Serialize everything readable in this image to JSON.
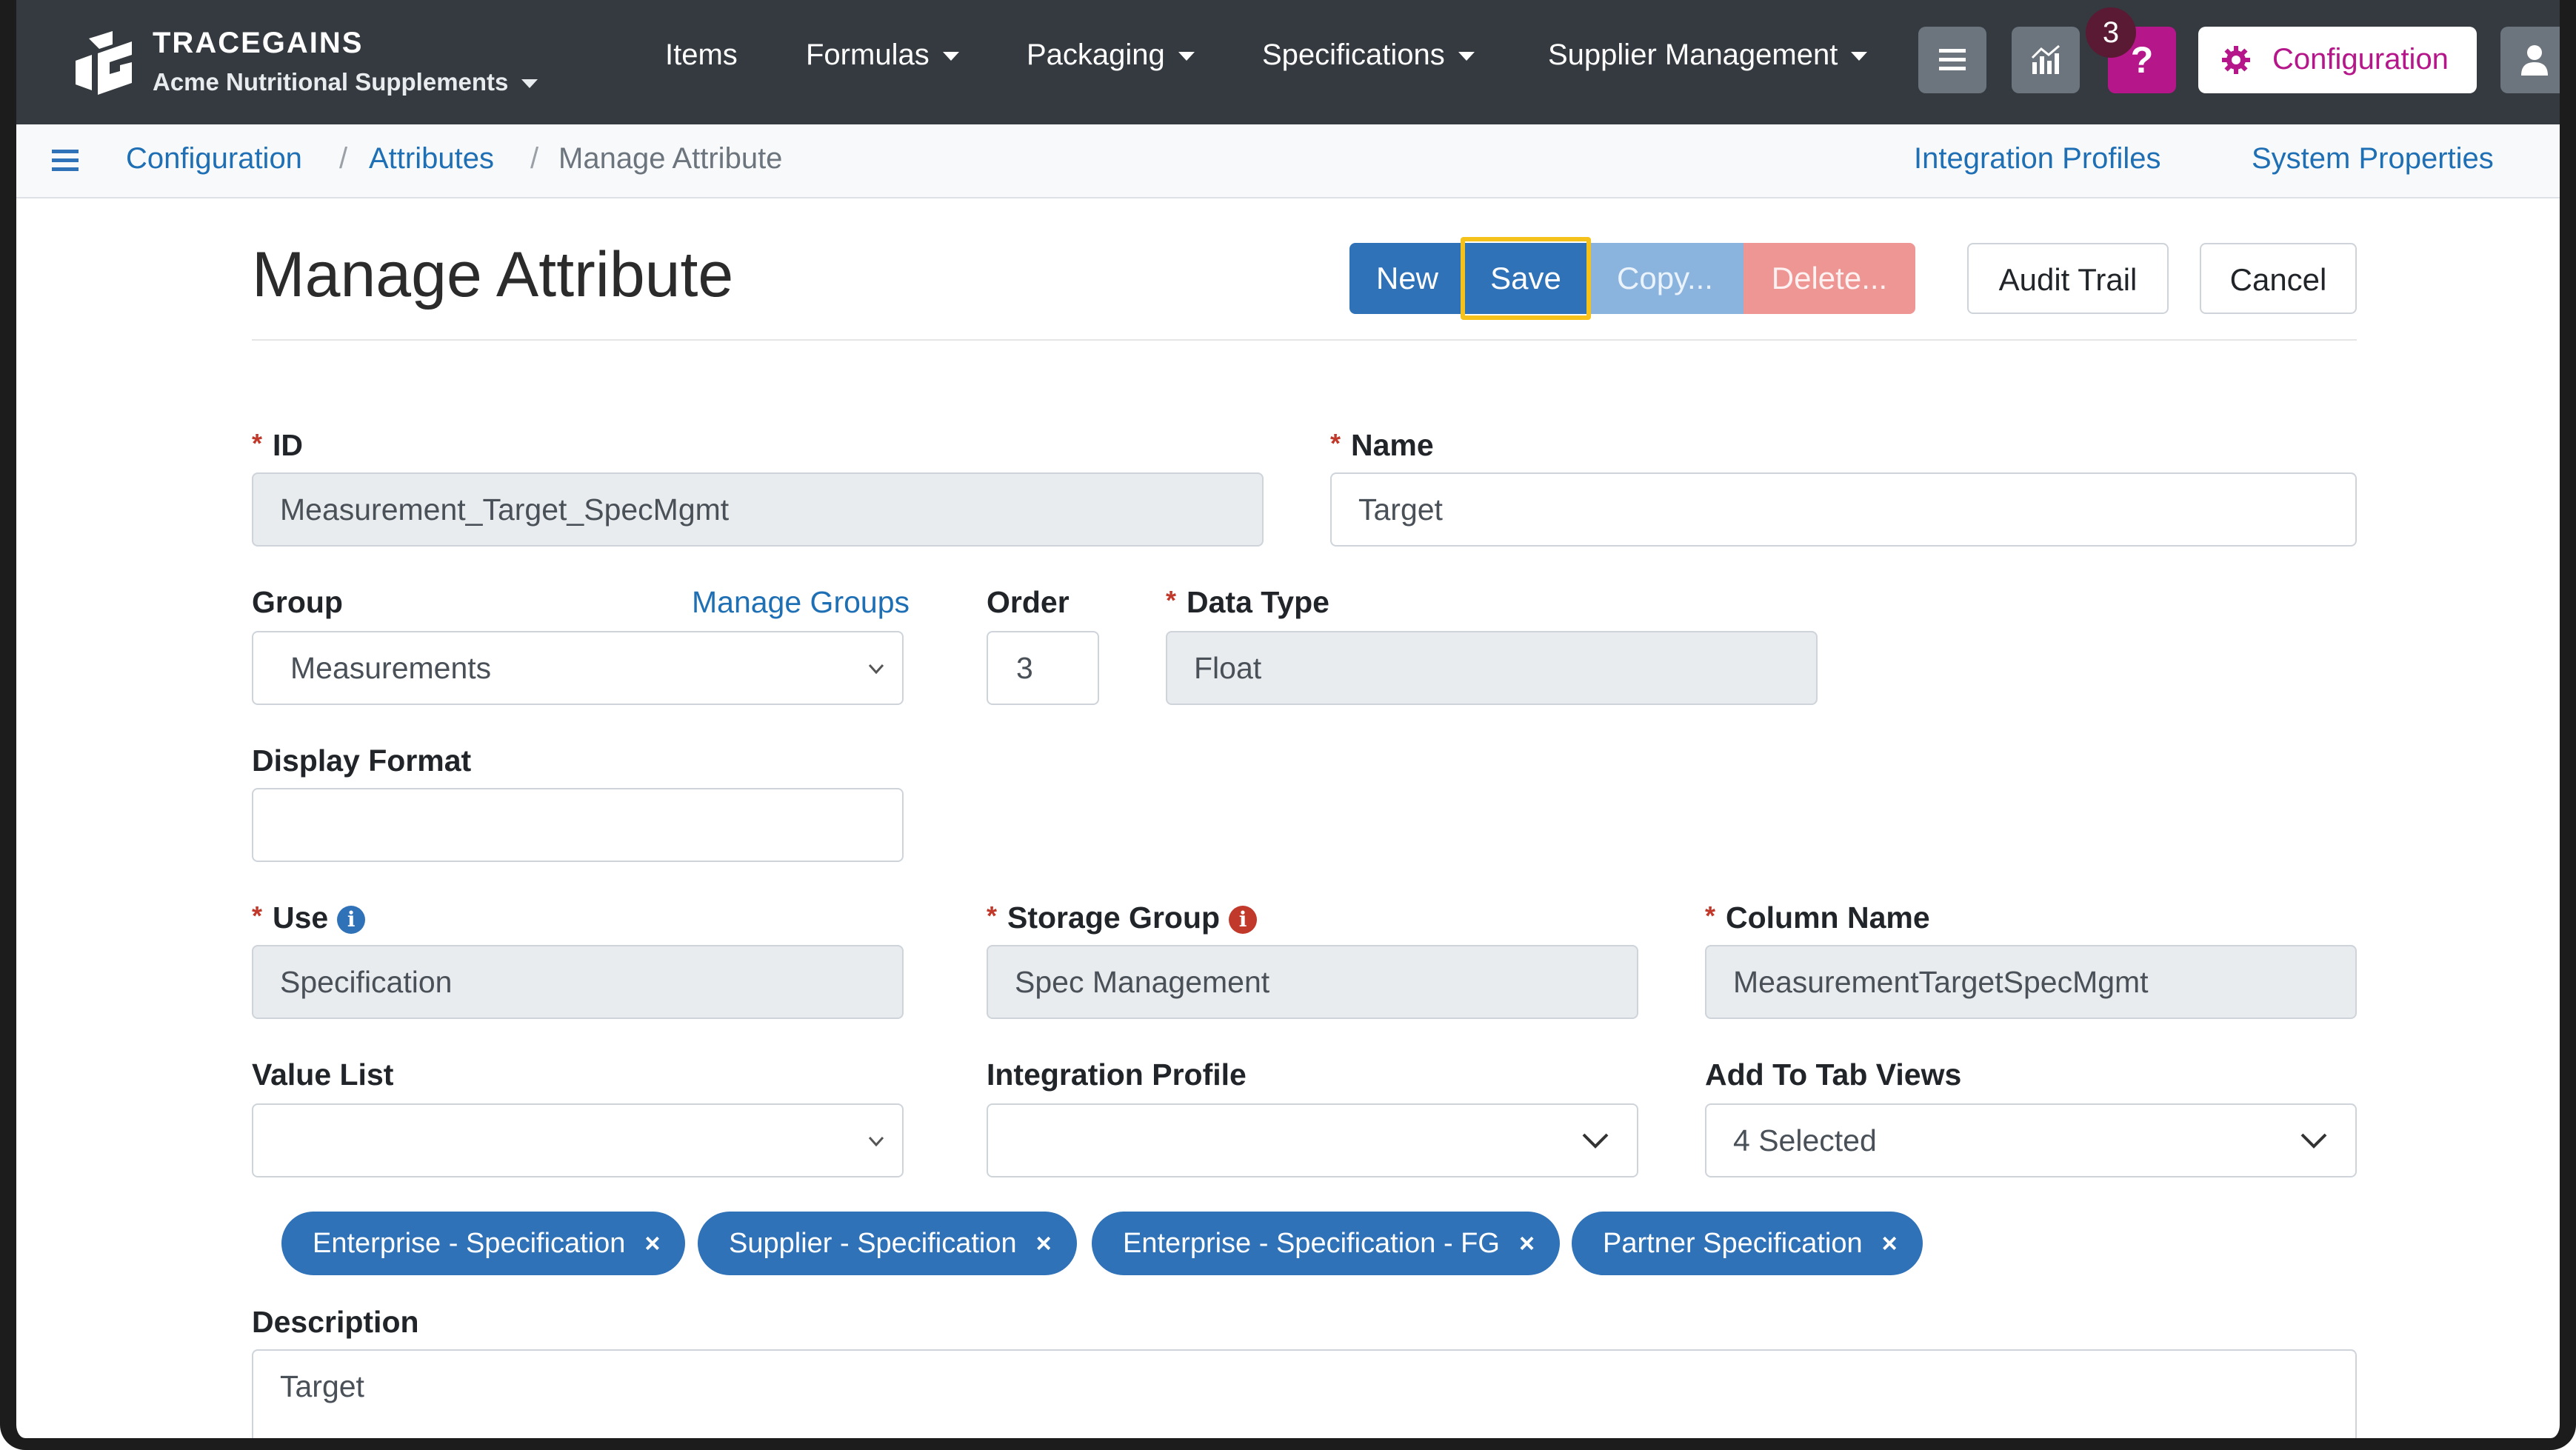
{
  "brand": {
    "name": "TRACEGAINS",
    "org": "Acme Nutritional Supplements"
  },
  "nav": {
    "items": [
      "Items",
      "Formulas",
      "Packaging",
      "Specifications",
      "Supplier Management"
    ],
    "notification_count": "3",
    "help_label": "?",
    "config_label": "Configuration"
  },
  "breadcrumb": {
    "items": [
      "Configuration",
      "Attributes",
      "Manage Attribute"
    ],
    "right_links": [
      "Integration Profiles",
      "System Properties"
    ]
  },
  "page": {
    "title": "Manage Attribute"
  },
  "toolbar": {
    "new_label": "New",
    "save_label": "Save",
    "copy_label": "Copy...",
    "delete_label": "Delete...",
    "audit_label": "Audit Trail",
    "cancel_label": "Cancel"
  },
  "form": {
    "id": {
      "label": "ID",
      "value": "Measurement_Target_SpecMgmt"
    },
    "name": {
      "label": "Name",
      "value": "Target"
    },
    "group": {
      "label": "Group",
      "value": "Measurements",
      "manage_link": "Manage Groups"
    },
    "order": {
      "label": "Order",
      "value": "3"
    },
    "data_type": {
      "label": "Data Type",
      "value": "Float"
    },
    "display_format": {
      "label": "Display Format",
      "value": ""
    },
    "use": {
      "label": "Use",
      "value": "Specification"
    },
    "storage_group": {
      "label": "Storage Group",
      "value": "Spec Management"
    },
    "column_name": {
      "label": "Column Name",
      "value": "MeasurementTargetSpecMgmt"
    },
    "value_list": {
      "label": "Value List",
      "value": ""
    },
    "integration_profile": {
      "label": "Integration Profile",
      "value": ""
    },
    "tab_views": {
      "label": "Add To Tab Views",
      "value": "4 Selected",
      "chips": [
        "Enterprise - Specification",
        "Supplier - Specification",
        "Enterprise - Specification - FG",
        "Partner Specification"
      ]
    },
    "description": {
      "label": "Description",
      "value": "Target"
    },
    "required_marker": "*",
    "chip_remove": "×"
  },
  "colors": {
    "navbar": "#343a40",
    "primary": "#2f72b8",
    "help": "#b5178a",
    "highlight": "#f4c21b",
    "danger_light": "#ee9693"
  },
  "icons": [
    "logo-icon",
    "chevron-down-icon",
    "menu-icon",
    "analytics-icon",
    "help-icon",
    "gear-icon",
    "user-icon",
    "info-icon",
    "close-icon"
  ]
}
